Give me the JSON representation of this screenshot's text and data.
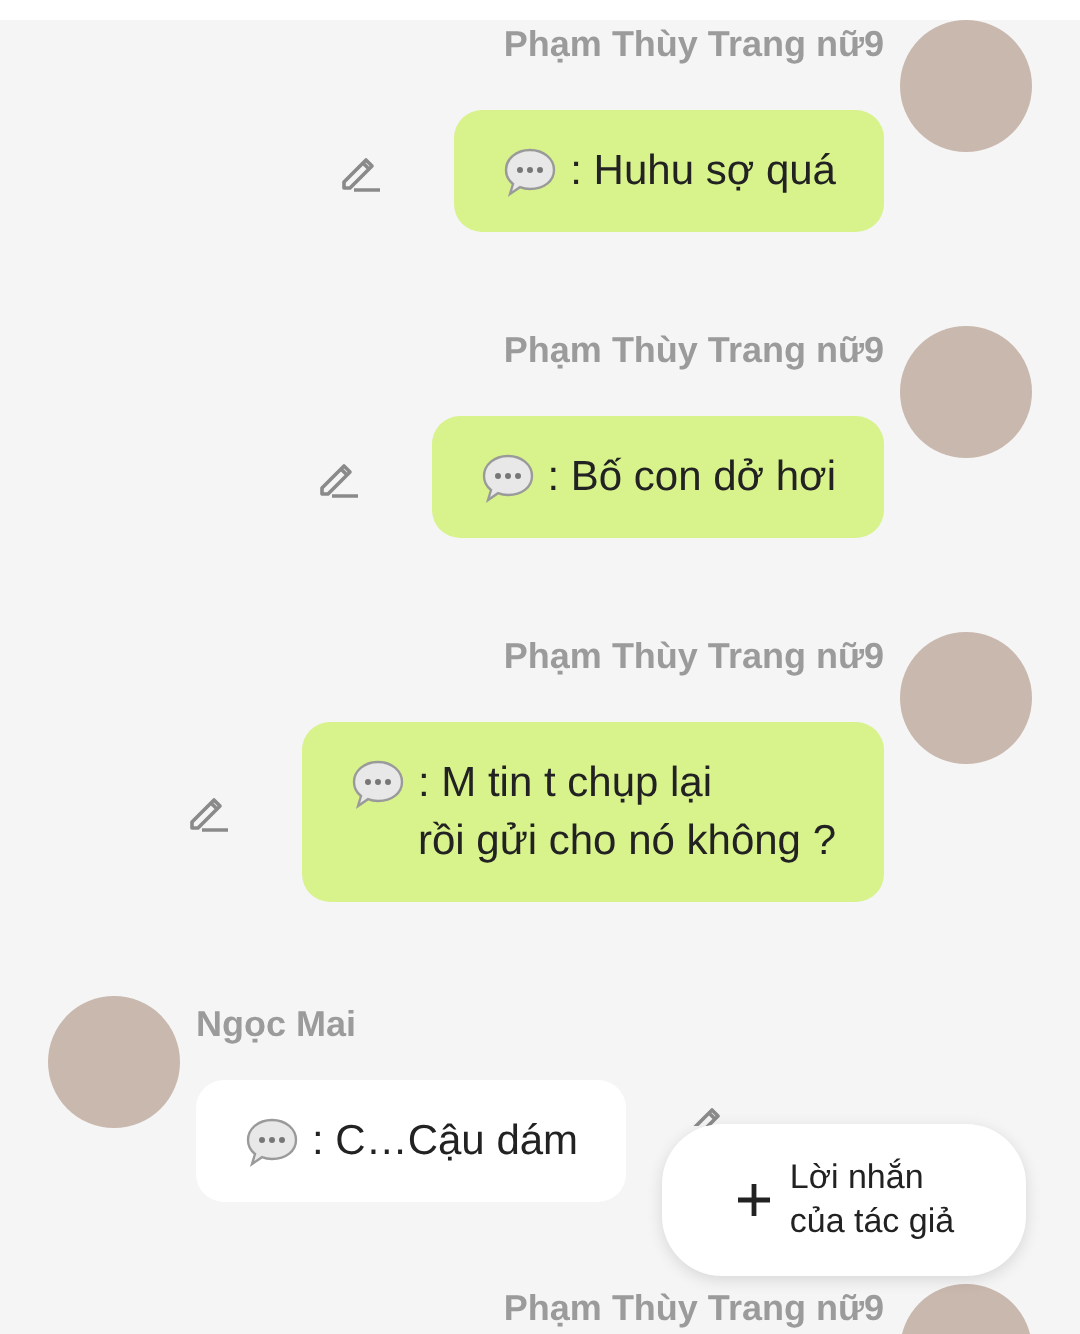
{
  "messages": [
    {
      "kind": "outgoing",
      "name": "Phạm Thùy Trang nữ9",
      "lines": [
        ": Huhu sợ quá"
      ]
    },
    {
      "kind": "outgoing",
      "name": "Phạm Thùy Trang nữ9",
      "lines": [
        ": Bố con dở hơi"
      ]
    },
    {
      "kind": "outgoing",
      "name": "Phạm Thùy Trang nữ9",
      "lines": [
        ": M tin t chụp lại",
        "rồi gửi cho nó không ?"
      ]
    },
    {
      "kind": "incoming",
      "name": "Ngọc Mai",
      "lines": [
        ": C…Cậu dám"
      ]
    },
    {
      "kind": "outgoing",
      "name": "Phạm Thùy Trang nữ9"
    }
  ],
  "author_note_button": {
    "lines": [
      "Lời nhắn",
      "của tác giả"
    ]
  }
}
